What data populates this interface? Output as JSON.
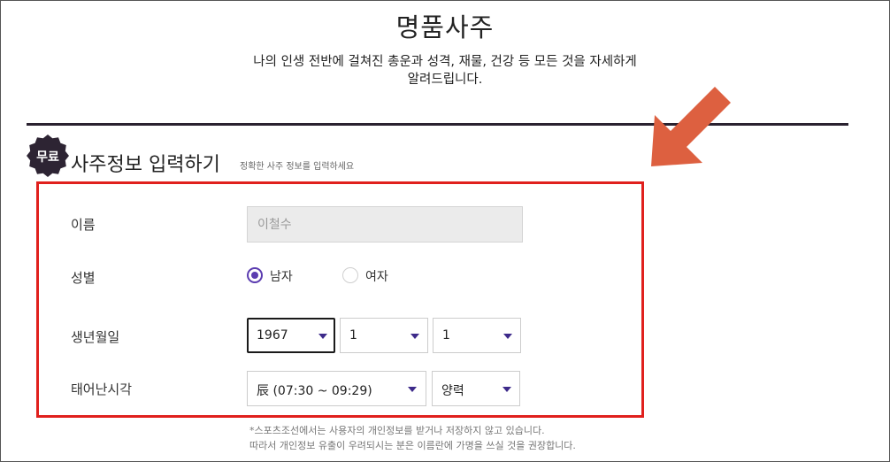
{
  "header": {
    "title": "명품사주",
    "description_line1": "나의 인생 전반에 걸쳐진 총운과 성격, 재물, 건강 등 모든 것을 자세하게",
    "description_line2": "알려드립니다."
  },
  "section": {
    "badge": "무료",
    "title": "사주정보 입력하기",
    "subtitle": "정확한 사주 정보를 입력하세요"
  },
  "form": {
    "name": {
      "label": "이름",
      "placeholder": "이철수",
      "value": ""
    },
    "gender": {
      "label": "성별",
      "options": [
        "남자",
        "여자"
      ],
      "selected": "남자"
    },
    "birth": {
      "label": "생년월일",
      "year": "1967",
      "month": "1",
      "day": "1"
    },
    "birth_time": {
      "label": "태어난시각",
      "time": "辰 (07:30 ~ 09:29)",
      "calendar": "양력"
    }
  },
  "notice": {
    "line1": "*스포츠조선에서는 사용자의 개인정보를 받거나 저장하지 않고 있습니다.",
    "line2": "따라서 개인정보 유출이 우려되시는 분은 이름란에 가명을 쓰실 것을 권장합니다."
  },
  "colors": {
    "accent": "#5b3cb0",
    "badge": "#2d2433",
    "highlight_box": "#e0201d",
    "annotation_arrow": "#dd6040"
  },
  "icons": {
    "badge_shape": "starburst-badge-icon",
    "annotation": "arrow-pointing-down-left-icon",
    "dropdown": "caret-down-icon"
  }
}
